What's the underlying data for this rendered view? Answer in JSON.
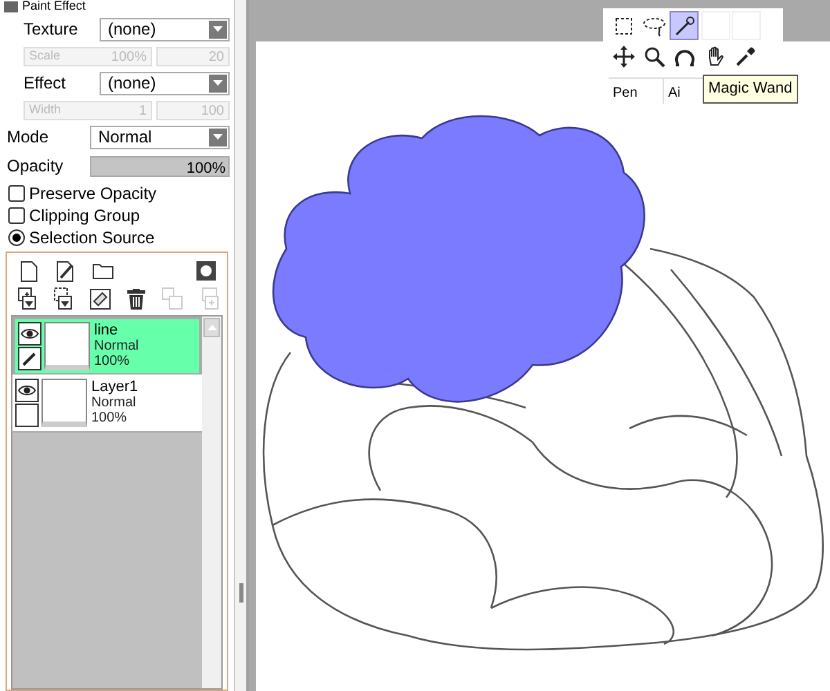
{
  "brush_panel": {
    "paint_effect": {
      "title": "Paint Effect",
      "checked": true
    },
    "rows": [
      {
        "kind": "dropdown",
        "label": "Texture",
        "value": "(none)",
        "indent": true
      },
      {
        "kind": "params",
        "disabled": true,
        "fields": [
          {
            "label": "Scale",
            "value": "100%"
          },
          {
            "value": "20"
          }
        ]
      },
      {
        "kind": "dropdown",
        "label": "Effect",
        "value": "(none)",
        "indent": true
      },
      {
        "kind": "params",
        "disabled": true,
        "fields": [
          {
            "label": "Width",
            "value": "1"
          },
          {
            "value": "100"
          }
        ]
      },
      {
        "kind": "dropdown",
        "label": "Mode",
        "value": "Normal",
        "indent": false
      },
      {
        "kind": "slider",
        "label": "Opacity",
        "reading": "100%",
        "level": 1
      }
    ],
    "options": [
      {
        "kind": "checkbox",
        "label": "Preserve Opacity",
        "checked": false
      },
      {
        "kind": "checkbox",
        "label": "Clipping Group",
        "checked": false
      },
      {
        "kind": "radio",
        "label": "Selection Source",
        "checked": true
      }
    ]
  },
  "layers": [
    {
      "name": "line",
      "mode": "Normal",
      "opacity": "100%",
      "selected": true
    },
    {
      "name": "Layer1",
      "mode": "Normal",
      "opacity": "100%",
      "selected": false
    }
  ],
  "toolbox": {
    "tools": [
      {
        "kind": "rect-select",
        "selected": false
      },
      {
        "kind": "lasso",
        "selected": false
      },
      {
        "kind": "magic-wand",
        "selected": true
      },
      {
        "kind": "empty",
        "selected": false
      },
      {
        "kind": "empty",
        "selected": false
      },
      {
        "kind": "move",
        "selected": false
      },
      {
        "kind": "zoom",
        "selected": false
      },
      {
        "kind": "rotate",
        "selected": false
      },
      {
        "kind": "hand",
        "selected": false
      },
      {
        "kind": "eyedropper",
        "selected": false
      }
    ],
    "tabs": [
      {
        "label": "Pen"
      },
      {
        "label": "Ai"
      }
    ],
    "tooltip": "Magic Wand"
  }
}
